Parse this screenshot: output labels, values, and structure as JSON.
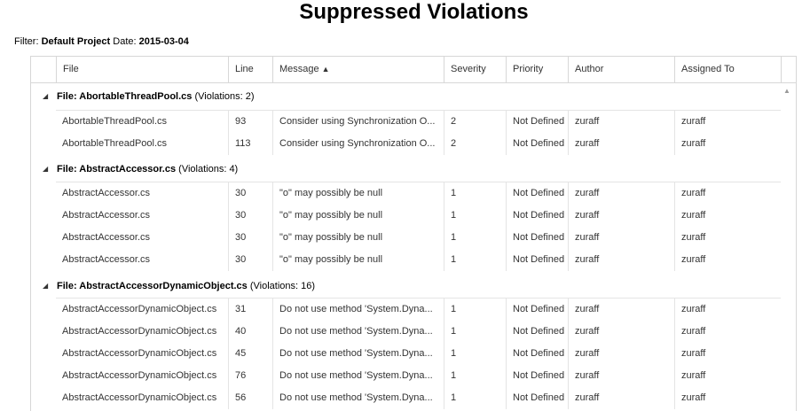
{
  "title": "Suppressed Violations",
  "filter": {
    "filter_label": "Filter:",
    "filter_value": "Default Project",
    "date_label": "Date:",
    "date_value": "2015-03-04"
  },
  "columns": {
    "file": "File",
    "line": "Line",
    "message": "Message",
    "message_sort": "▲",
    "severity": "Severity",
    "priority": "Priority",
    "author": "Author",
    "assigned_to": "Assigned To"
  },
  "groups": [
    {
      "label": "File: AbortableThreadPool.cs",
      "count": "(Violations: 2)",
      "rows": [
        {
          "file": "AbortableThreadPool.cs",
          "line": "93",
          "message": "Consider using Synchronization O...",
          "severity": "2",
          "priority": "Not Defined",
          "author": "zuraff",
          "assigned": "zuraff"
        },
        {
          "file": "AbortableThreadPool.cs",
          "line": "113",
          "message": "Consider using Synchronization O...",
          "severity": "2",
          "priority": "Not Defined",
          "author": "zuraff",
          "assigned": "zuraff"
        }
      ]
    },
    {
      "label": "File: AbstractAccessor.cs",
      "count": "(Violations: 4)",
      "rows": [
        {
          "file": "AbstractAccessor.cs",
          "line": "30",
          "message": "\"o\" may possibly be null",
          "severity": "1",
          "priority": "Not Defined",
          "author": "zuraff",
          "assigned": "zuraff"
        },
        {
          "file": "AbstractAccessor.cs",
          "line": "30",
          "message": "\"o\" may possibly be null",
          "severity": "1",
          "priority": "Not Defined",
          "author": "zuraff",
          "assigned": "zuraff"
        },
        {
          "file": "AbstractAccessor.cs",
          "line": "30",
          "message": "\"o\" may possibly be null",
          "severity": "1",
          "priority": "Not Defined",
          "author": "zuraff",
          "assigned": "zuraff"
        },
        {
          "file": "AbstractAccessor.cs",
          "line": "30",
          "message": "\"o\" may possibly be null",
          "severity": "1",
          "priority": "Not Defined",
          "author": "zuraff",
          "assigned": "zuraff"
        }
      ]
    },
    {
      "label": "File: AbstractAccessorDynamicObject.cs",
      "count": "(Violations: 16)",
      "rows": [
        {
          "file": "AbstractAccessorDynamicObject.cs",
          "line": "31",
          "message": "Do not use method 'System.Dyna...",
          "severity": "1",
          "priority": "Not Defined",
          "author": "zuraff",
          "assigned": "zuraff"
        },
        {
          "file": "AbstractAccessorDynamicObject.cs",
          "line": "40",
          "message": "Do not use method 'System.Dyna...",
          "severity": "1",
          "priority": "Not Defined",
          "author": "zuraff",
          "assigned": "zuraff"
        },
        {
          "file": "AbstractAccessorDynamicObject.cs",
          "line": "45",
          "message": "Do not use method 'System.Dyna...",
          "severity": "1",
          "priority": "Not Defined",
          "author": "zuraff",
          "assigned": "zuraff"
        },
        {
          "file": "AbstractAccessorDynamicObject.cs",
          "line": "76",
          "message": "Do not use method 'System.Dyna...",
          "severity": "1",
          "priority": "Not Defined",
          "author": "zuraff",
          "assigned": "zuraff"
        },
        {
          "file": "AbstractAccessorDynamicObject.cs",
          "line": "56",
          "message": "Do not use method 'System.Dyna...",
          "severity": "1",
          "priority": "Not Defined",
          "author": "zuraff",
          "assigned": "zuraff"
        }
      ]
    }
  ],
  "icons": {
    "collapse": "collapse-triangle-icon",
    "scroll_up": "scroll-up-arrow-icon"
  }
}
